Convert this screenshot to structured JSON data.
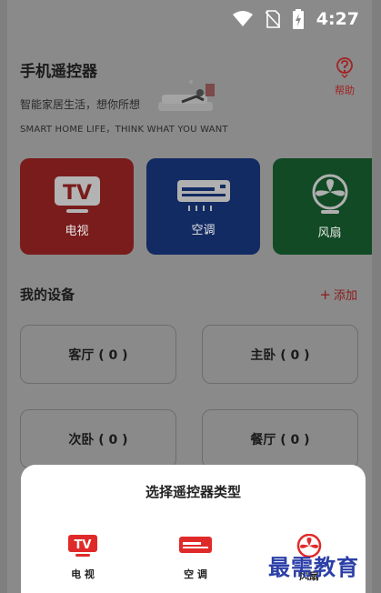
{
  "status_bar": {
    "time": "4:27"
  },
  "header": {
    "title": "手机遥控器",
    "help_label": "帮助",
    "tagline": "智能家居生活，想你所想",
    "tagline_en": "SMART HOME LIFE，THINK WHAT YOU WANT"
  },
  "categories": [
    {
      "label": "电视",
      "icon": "tv-icon"
    },
    {
      "label": "空调",
      "icon": "air-conditioner-icon"
    },
    {
      "label": "风扇",
      "icon": "fan-icon"
    }
  ],
  "my_devices": {
    "title": "我的设备",
    "add_label": "添加",
    "rooms": [
      "客厅 ( 0 )",
      "主卧 ( 0 )",
      "次卧 ( 0 )",
      "餐厅 ( 0 )"
    ]
  },
  "sheet": {
    "title": "选择遥控器类型",
    "options": [
      {
        "label": "电 视",
        "icon": "tv-icon"
      },
      {
        "label": "空 调",
        "icon": "air-conditioner-icon"
      },
      {
        "label": "风扇",
        "icon": "fan-icon"
      }
    ]
  },
  "watermark": "最需教育",
  "colors": {
    "accent_red": "#e02a2a",
    "tv_card": "#e03a3a",
    "ac_card": "#2e5bd6",
    "fan_card": "#22a04a"
  }
}
